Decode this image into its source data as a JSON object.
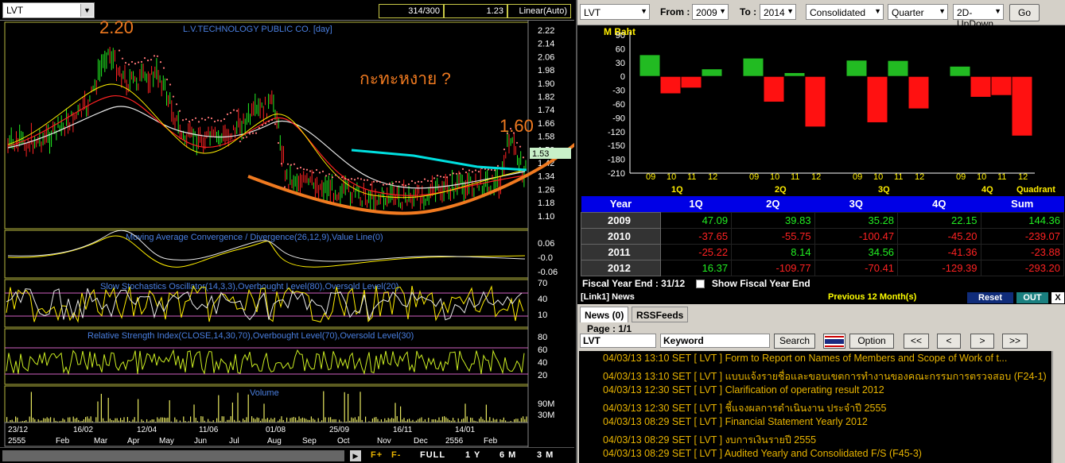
{
  "left_panel": {
    "symbol": "LVT",
    "bar_count": "314/300",
    "last_value": "1.23",
    "scale_mode": "Linear(Auto)",
    "chart_title": "L.V.TECHNOLOGY PUBLIC CO. [day]",
    "annotation_high": "2.20",
    "annotation_thai": "กะทะหงาย ?",
    "annotation_low": "1.60",
    "price_tag": "1.53",
    "price_axis": [
      "2.22",
      "2.14",
      "2.06",
      "1.98",
      "1.90",
      "1.82",
      "1.74",
      "1.66",
      "1.58",
      "1.50",
      "1.42",
      "1.34",
      "1.26",
      "1.18",
      "1.10"
    ],
    "macd_title": "Moving Average Convergence / Divergence(26,12,9),Value Line(0)",
    "macd_axis": [
      "0.06",
      "-0.0",
      "-0.06"
    ],
    "stoch_title": "Slow Stochastics Oscillator(14,3,3),Overbought Level(80),Oversold Level(20)",
    "stoch_axis": [
      "70",
      "40",
      "10"
    ],
    "rsi_title": "Relative Strength Index(CLOSE,14,30,70),Overbought Level(70),Oversold Level(30)",
    "rsi_axis": [
      "80",
      "60",
      "40",
      "20"
    ],
    "volume_title": "Volume",
    "volume_axis": [
      "90M",
      "30M"
    ],
    "date_top": [
      "23/12",
      "16/02",
      "12/04",
      "11/06",
      "01/08",
      "25/09",
      "16/11",
      "14/01"
    ],
    "date_bottom": [
      "2555",
      "Feb",
      "Mar",
      "Apr",
      "May",
      "Jun",
      "Jul",
      "Aug",
      "Sep",
      "Oct",
      "Nov",
      "Dec",
      "2556",
      "Feb"
    ],
    "toolbar": [
      "F+",
      "F-",
      "FULL",
      "1 Y",
      "6 M",
      "3 M"
    ]
  },
  "right_panel": {
    "symbol": "LVT",
    "from_label": "From :",
    "from_value": "2009",
    "to_label": "To :",
    "to_value": "2014",
    "statement": "Consolidated",
    "period": "Quarter",
    "view": "2D-UpDown",
    "go_label": "Go",
    "chart_unit": "M Baht",
    "quadrant_label": "Quadrant",
    "fiscal_label": "Fiscal  Year  End  :  31/12",
    "show_fiscal": "Show Fiscal Year End"
  },
  "chart_data": {
    "type": "bar",
    "ylabel": "M Baht",
    "ylim": [
      -210,
      90
    ],
    "yticks": [
      "90",
      "60",
      "30",
      "0",
      "-30",
      "-60",
      "-90",
      "-120",
      "-150",
      "-180",
      "-210"
    ],
    "groups": [
      "1Q",
      "2Q",
      "3Q",
      "4Q"
    ],
    "categories": [
      "09",
      "10",
      "11",
      "12"
    ],
    "series": [
      {
        "values": [
          47.09,
          -37.65,
          -25.22,
          16.37
        ]
      },
      {
        "values": [
          39.83,
          -55.75,
          8.14,
          -109.77
        ]
      },
      {
        "values": [
          35.28,
          -100.47,
          34.56,
          -70.41
        ]
      },
      {
        "values": [
          22.15,
          -45.2,
          -41.36,
          -129.39
        ]
      }
    ],
    "colors": {
      "positive": "#22bb22",
      "negative": "#ff1111"
    }
  },
  "table": {
    "headers": [
      "Year",
      "1Q",
      "2Q",
      "3Q",
      "4Q",
      "Sum"
    ],
    "rows": [
      {
        "year": "2009",
        "values": [
          "47.09",
          "39.83",
          "35.28",
          "22.15",
          "144.36"
        ]
      },
      {
        "year": "2010",
        "values": [
          "-37.65",
          "-55.75",
          "-100.47",
          "-45.20",
          "-239.07"
        ]
      },
      {
        "year": "2011",
        "values": [
          "-25.22",
          "8.14",
          "34.56",
          "-41.36",
          "-23.88"
        ]
      },
      {
        "year": "2012",
        "values": [
          "16.37",
          "-109.77",
          "-70.41",
          "-129.39",
          "-293.20"
        ]
      }
    ]
  },
  "news": {
    "header": "[Link1] News",
    "previous": "Previous 12 Month(s)",
    "reset": "Reset",
    "out": "OUT",
    "close": "X",
    "tab_news": "News (0)",
    "tab_rss": "RSSFeeds",
    "page": "Page : 1/1",
    "symbol": "LVT",
    "keyword": "Keyword",
    "search": "Search",
    "option": "Option",
    "nav": [
      "<<",
      "<",
      ">",
      ">>"
    ],
    "items": [
      "04/03/13 13:10  SET  [ LVT ]  Form to Report on Names of Members and Scope of Work of t...",
      "04/03/13 13:10  SET  [ LVT ]  แบบแจ้งรายชื่อและขอบเขตการทำงานของคณะกรรมการตรวจสอบ (F24-1)",
      "04/03/13 12:30  SET  [ LVT ]  Clarification of operating result 2012",
      "04/03/13 12:30  SET  [ LVT ]  ชี้แจงผลการดำเนินงาน ประจำปี 2555",
      "04/03/13 08:29  SET  [ LVT ]  Financial Statement Yearly 2012",
      "04/03/13 08:29  SET  [ LVT ]  งบการเงินรายปี 2555",
      "04/03/13 08:29  SET  [ LVT ]  Audited Yearly and Consolidated F/S (F45-3)"
    ]
  }
}
